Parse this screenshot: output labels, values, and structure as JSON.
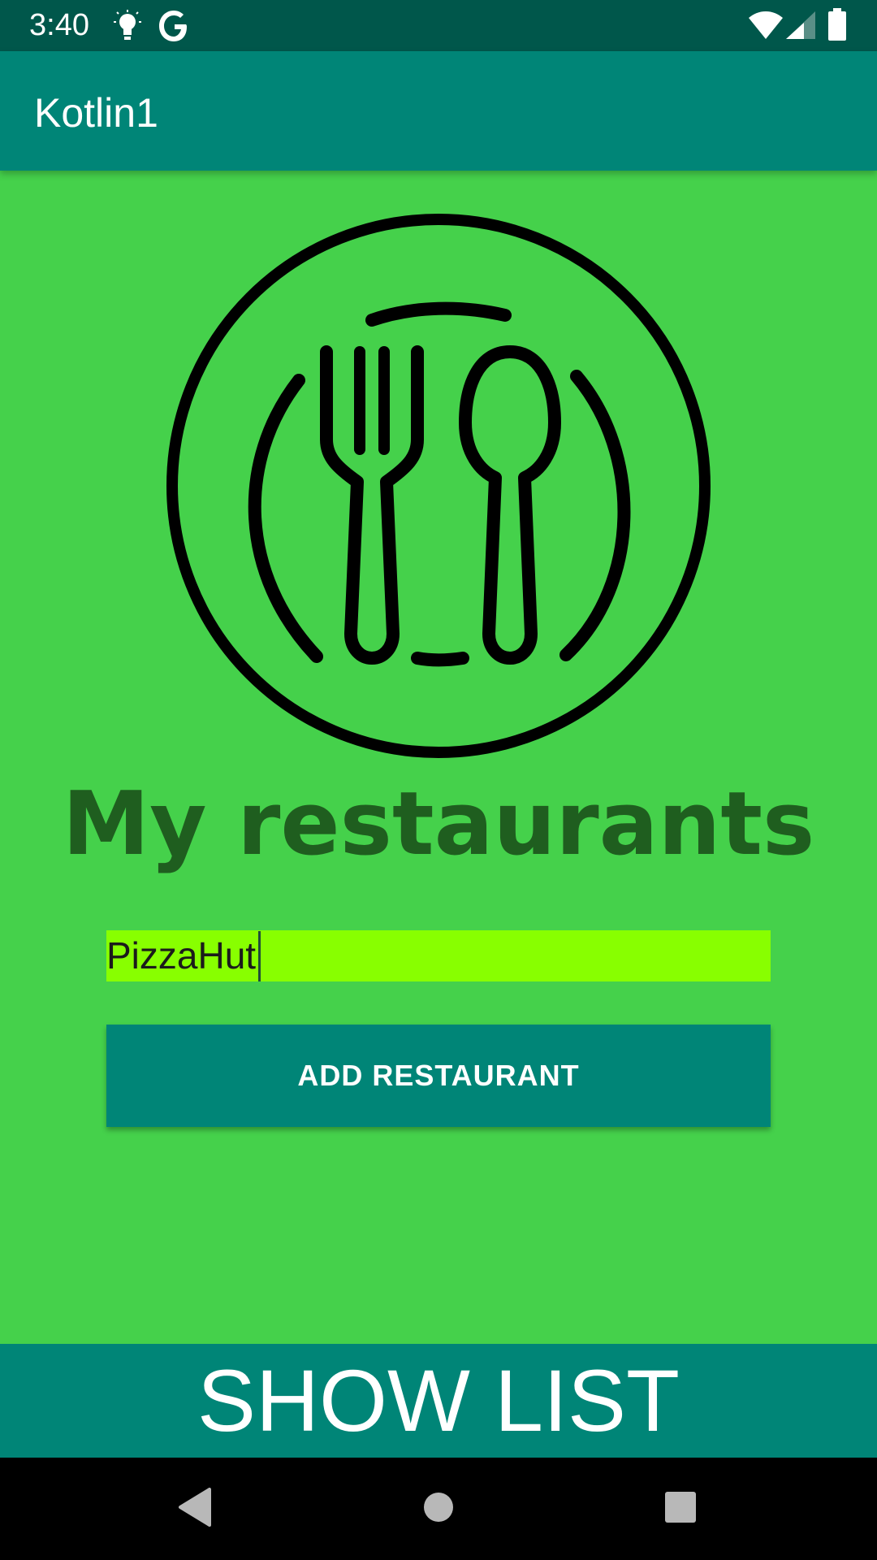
{
  "status_bar": {
    "time": "3:40",
    "icons": [
      "lightbulb-icon",
      "google-g-icon",
      "wifi-icon",
      "signal-icon",
      "battery-icon"
    ],
    "background": "#00574b"
  },
  "app_bar": {
    "title": "Kotlin1",
    "background": "#008577"
  },
  "main": {
    "background": "#45d14b",
    "logo_icon": "plate-fork-spoon-icon",
    "heading": "My restaurants",
    "heading_color": "#1f5e1f",
    "input": {
      "value": "PizzaHut",
      "placeholder": "",
      "background": "#88ff00"
    },
    "add_button_label": "ADD RESTAURANT"
  },
  "bottom": {
    "show_list_label": "SHOW LIST"
  },
  "nav_bar": {
    "buttons": [
      "back-icon",
      "home-icon",
      "recents-icon"
    ]
  }
}
